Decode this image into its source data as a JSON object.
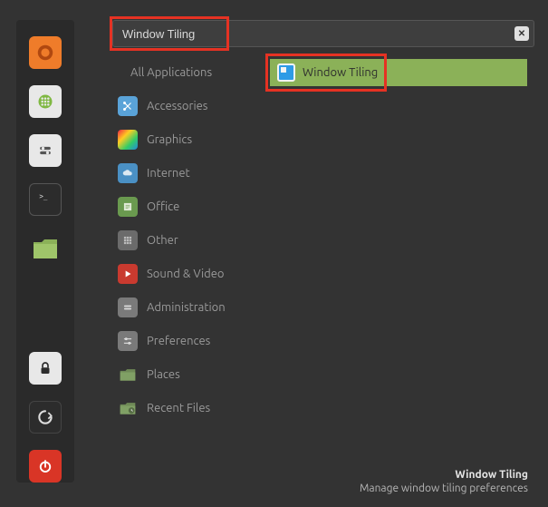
{
  "search": {
    "value": "Window Tiling",
    "clear_glyph": "✕"
  },
  "categories": {
    "all": "All Applications",
    "accessories": "Accessories",
    "graphics": "Graphics",
    "internet": "Internet",
    "office": "Office",
    "other": "Other",
    "sound_video": "Sound & Video",
    "administration": "Administration",
    "preferences": "Preferences",
    "places": "Places",
    "recent_files": "Recent Files"
  },
  "result": {
    "label": "Window Tiling"
  },
  "description": {
    "title": "Window Tiling",
    "subtitle": "Manage window tiling preferences"
  }
}
